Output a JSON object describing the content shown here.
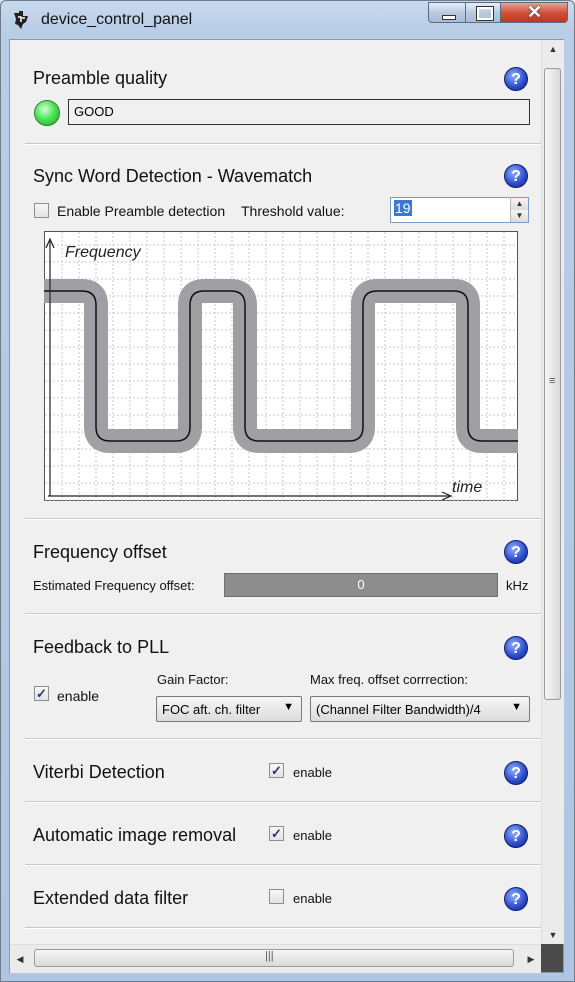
{
  "window": {
    "title": "device_control_panel"
  },
  "preamble": {
    "title": "Preamble quality",
    "status": "GOOD",
    "help": "?"
  },
  "sync": {
    "title": "Sync Word Detection - Wavematch",
    "enable_label": "Enable Preamble detection",
    "enable_checked": false,
    "threshold_label": "Threshold value:",
    "threshold_value": "19",
    "help": "?",
    "diagram": {
      "y_label": "Frequency",
      "x_label": "time"
    }
  },
  "freq_offset": {
    "title": "Frequency offset",
    "estimated_label": "Estimated Frequency offset:",
    "value": "0",
    "unit": "kHz",
    "help": "?"
  },
  "pll": {
    "title": "Feedback to PLL",
    "enable_label": "enable",
    "enable_checked": true,
    "gain_label": "Gain Factor:",
    "gain_value": "FOC aft. ch. filter",
    "maxfreq_label": "Max freq. offset corrrection:",
    "maxfreq_value": "(Channel Filter Bandwidth)/4",
    "help": "?"
  },
  "viterbi": {
    "title": "Viterbi Detection",
    "enable_label": "enable",
    "enable_checked": true,
    "help": "?"
  },
  "image_removal": {
    "title": "Automatic image removal",
    "enable_label": "enable",
    "enable_checked": true,
    "help": "?"
  },
  "ext_filter": {
    "title": "Extended data filter",
    "enable_label": "enable",
    "enable_checked": false,
    "help": "?"
  },
  "icons": {
    "app": "ti-logo-icon",
    "help": "question-mark-icon",
    "led": "green-led-icon",
    "check": "check-mark-icon"
  },
  "colors": {
    "led": "#4ee65a",
    "help": "#2a49c9",
    "selection": "#3a78d6",
    "wave": "#a0a0a4"
  }
}
